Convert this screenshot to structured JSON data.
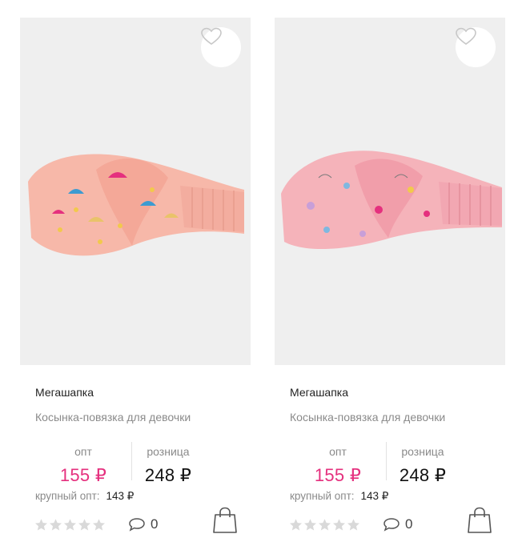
{
  "products": [
    {
      "brand": "Мегашапка",
      "name": "Косынка-повязка для девочки",
      "opt_label": "опт",
      "opt_price": "155 ₽",
      "retail_label": "розница",
      "retail_price": "248 ₽",
      "bulk_label": "крупный опт:",
      "bulk_price": "143 ₽",
      "rating": 0,
      "comments": "0",
      "colors": {
        "band": "#f7b8a9",
        "accent": "#e5307e"
      }
    },
    {
      "brand": "Мегашапка",
      "name": "Косынка-повязка для девочки",
      "opt_label": "опт",
      "opt_price": "155 ₽",
      "retail_label": "розница",
      "retail_price": "248 ₽",
      "bulk_label": "крупный опт:",
      "bulk_price": "143 ₽",
      "rating": 0,
      "comments": "0",
      "colors": {
        "band": "#f5b3ba",
        "accent": "#e5307e"
      }
    }
  ],
  "icons": {
    "favorite": "heart-outline-icon",
    "comment": "speech-bubble-icon",
    "cart": "shopping-bag-icon",
    "rating": "star-icon"
  }
}
